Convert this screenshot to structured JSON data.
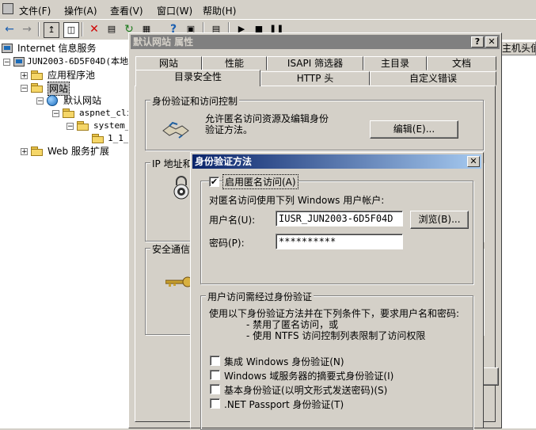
{
  "menubar": {
    "items": [
      "文件(F)",
      "操作(A)",
      "查看(V)",
      "窗口(W)",
      "帮助(H)"
    ]
  },
  "tree": {
    "root": "Internet 信息服务",
    "server": "JUN2003-6D5F04D(本地",
    "app_pools": "应用程序池",
    "websites": "网站",
    "default_site": "默认网站",
    "aspnet": "aspnet_cli",
    "system": "system_",
    "subfolder": "1_1_",
    "web_ext": "Web 服务扩展"
  },
  "right_panel": {
    "column_header": "主机头值"
  },
  "property_dialog": {
    "title": "默认网站 属性",
    "tabs_row1": [
      "网站",
      "性能",
      "ISAPI 筛选器",
      "主目录",
      "文档"
    ],
    "tabs_row2": [
      "目录安全性",
      "HTTP 头",
      "自定义错误"
    ],
    "auth_group_label": "身份验证和访问控制",
    "auth_desc": "允许匿名访问资源及编辑身份验证方法。",
    "edit_button": "编辑(E)...",
    "ip_group_label": "IP 地址和",
    "secure_group_label": "安全通信"
  },
  "auth_dialog": {
    "title": "身份验证方法",
    "enable_anon": "启用匿名访问(A)",
    "anon_checked": true,
    "anon_account_desc": "对匿名访问使用下列 Windows 用户帐户:",
    "username_label": "用户名(U):",
    "username_value": "IUSR_JUN2003-6D5F04D",
    "browse_button": "浏览(B)...",
    "password_label": "密码(P):",
    "password_value": "**********",
    "auth_group_label": "用户访问需经过身份验证",
    "auth_desc_line1": "使用以下身份验证方法并在下列条件下，要求用户名和密码:",
    "auth_desc_line2": "- 禁用了匿名访问，或",
    "auth_desc_line3": "- 使用 NTFS 访问控制列表限制了访问权限",
    "options": [
      {
        "label": "集成 Windows 身份验证(N)",
        "checked": false
      },
      {
        "label": "Windows 域服务器的摘要式身份验证(I)",
        "checked": false
      },
      {
        "label": "基本身份验证(以明文形式发送密码)(S)",
        "checked": false
      },
      {
        "label": ".NET Passport 身份验证(T)",
        "checked": false
      }
    ]
  }
}
